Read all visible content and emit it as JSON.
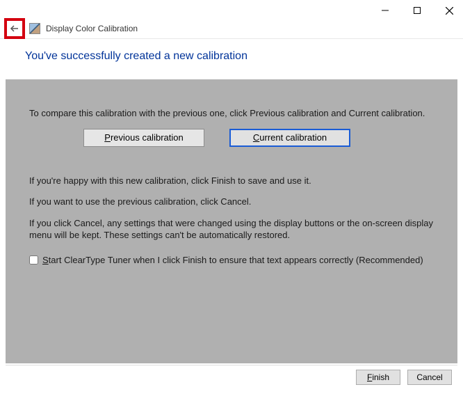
{
  "header": {
    "title": "Display Color Calibration"
  },
  "page": {
    "heading": "You've successfully created a new calibration"
  },
  "body": {
    "compare_text": "To compare this calibration with the previous one, click Previous calibration and Current calibration.",
    "previous_btn": "revious calibration",
    "previous_btn_accel": "P",
    "current_btn": "urrent calibration",
    "current_btn_accel": "C",
    "happy_text": "If you're happy with this new calibration, click Finish to save and use it.",
    "want_prev_text": "If you want to use the previous calibration, click Cancel.",
    "cancel_note": "If you click Cancel, any settings that were changed using the display buttons or the on-screen display menu will be kept. These settings can't be automatically restored.",
    "cleartype_accel": "S",
    "cleartype_rest": "tart ClearType Tuner when I click Finish to ensure that text appears correctly (Recommended)"
  },
  "footer": {
    "finish_accel": "F",
    "finish_rest": "inish",
    "cancel": "Cancel"
  }
}
